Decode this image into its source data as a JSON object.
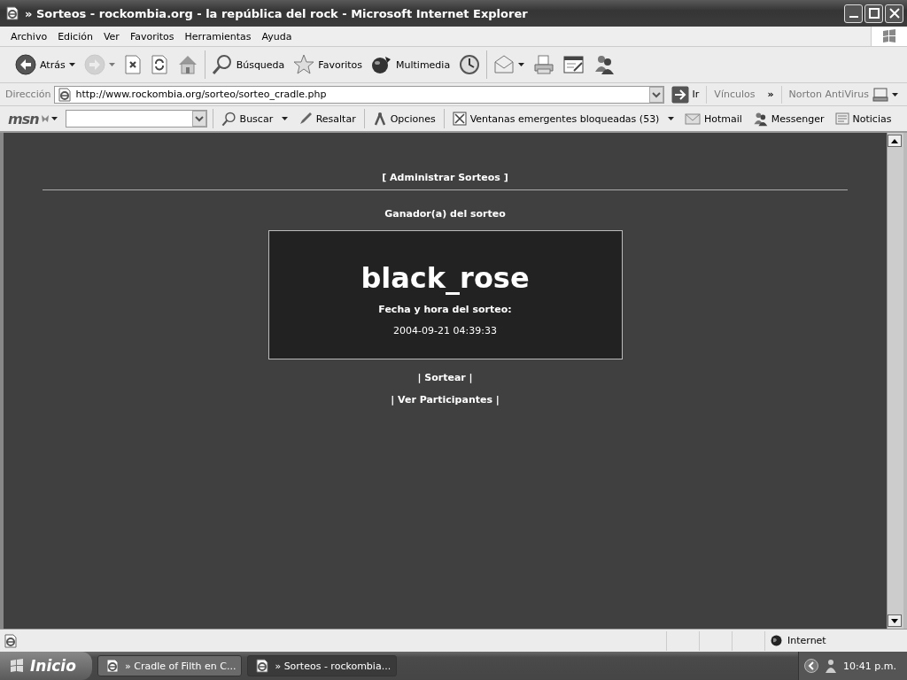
{
  "window": {
    "title": "» Sorteos - rockombia.org - la república del rock - Microsoft Internet Explorer"
  },
  "menu_bar": {
    "items": [
      "Archivo",
      "Edición",
      "Ver",
      "Favoritos",
      "Herramientas",
      "Ayuda"
    ]
  },
  "toolbar": {
    "groups": [
      [
        {
          "label": "Atrás",
          "disabled": false,
          "menu": true
        },
        {
          "disabled": true,
          "menu": true
        },
        {
          "disabled": false,
          "menu": false
        },
        {
          "disabled": false,
          "menu": false
        },
        {
          "disabled": false,
          "menu": false
        }
      ],
      [
        {
          "label": "Búsqueda",
          "disabled": false,
          "menu": false
        },
        {
          "label": "Favoritos",
          "disabled": false,
          "menu": false
        },
        {
          "label": "Multimedia",
          "disabled": false,
          "menu": false
        },
        {
          "disabled": false,
          "menu": false
        }
      ],
      [
        {
          "disabled": false,
          "menu": true
        },
        {
          "disabled": false,
          "menu": false
        },
        {
          "disabled": false,
          "menu": false
        },
        {
          "disabled": false,
          "menu": false
        }
      ]
    ]
  },
  "address_bar": {
    "label": "Dirección",
    "url": "http://www.rockombia.org/sorteo/sorteo_cradle.php",
    "go_label": "Ir",
    "links_label": "Vínculos",
    "links_chevron": "»",
    "norton_label": "Norton AntiVirus"
  },
  "msn_bar": {
    "logo": "msn",
    "items": [
      {
        "label": "Buscar",
        "menu": true
      },
      {
        "label": "Resaltar",
        "menu": false
      },
      {
        "label": "Opciones",
        "menu": false
      },
      {
        "label": "Ventanas emergentes bloqueadas (53)",
        "menu": true
      },
      {
        "label": "Hotmail",
        "menu": false
      },
      {
        "label": "Messenger",
        "menu": false
      },
      {
        "label": "Noticias",
        "menu": false
      }
    ]
  },
  "page": {
    "admin_link": "[ Administrar Sorteos ]",
    "heading": "Ganador(a) del sorteo",
    "winner": "black_rose",
    "date_label": "Fecha y hora del sorteo:",
    "date": "2004-09-21 04:39:33",
    "links": [
      "| Sortear |",
      "| Ver Participantes |"
    ]
  },
  "status_bar": {
    "zone": "Internet"
  },
  "taskbar": {
    "start": "Inicio",
    "tasks": [
      {
        "label": "» Cradle of Filth en C...",
        "selected": false
      },
      {
        "label": "» Sorteos - rockombia...",
        "selected": true
      }
    ],
    "clock": "10:41 p.m."
  }
}
